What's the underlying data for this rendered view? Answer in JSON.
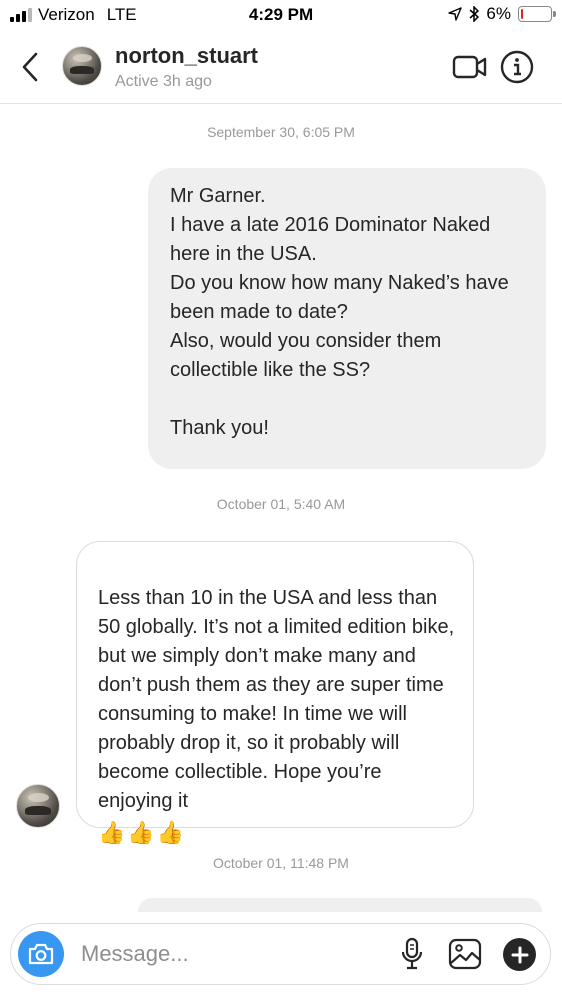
{
  "status_bar": {
    "carrier": "Verizon",
    "network": "LTE",
    "time": "4:29 PM",
    "battery": "6%",
    "battery_level": 0.06
  },
  "header": {
    "username": "norton_stuart",
    "status": "Active 3h ago",
    "icons": [
      "chevron-left-icon",
      "video-camera-icon",
      "info-icon"
    ]
  },
  "thread": {
    "timestamp_1": "September 30, 6:05 PM",
    "message_1": "Mr Garner.\nI have a late 2016 Dominator Naked here in the USA.\nDo you know how many Naked’s have been made to date?\nAlso, would you consider them collectible like the SS?\n\nThank you!",
    "timestamp_2": "October 01, 5:40 AM",
    "message_2": "Less than 10 in the USA and less than 50 globally. It’s not a limited edition bike, but we simply don’t make many and don’t push them as they are super time consuming to make! In time we will probably drop it, so it probably will become collectible. Hope you’re enjoying it",
    "message_2_emoji": "👍👍👍",
    "timestamp_3": "October 01, 11:48 PM"
  },
  "composer": {
    "placeholder": "Message...",
    "icons": [
      "camera-icon",
      "microphone-icon",
      "gallery-icon",
      "plus-icon"
    ]
  },
  "colors": {
    "accent": "#3897f0",
    "outgoing_bubble": "#efefef",
    "battery_low": "#e0241f"
  }
}
